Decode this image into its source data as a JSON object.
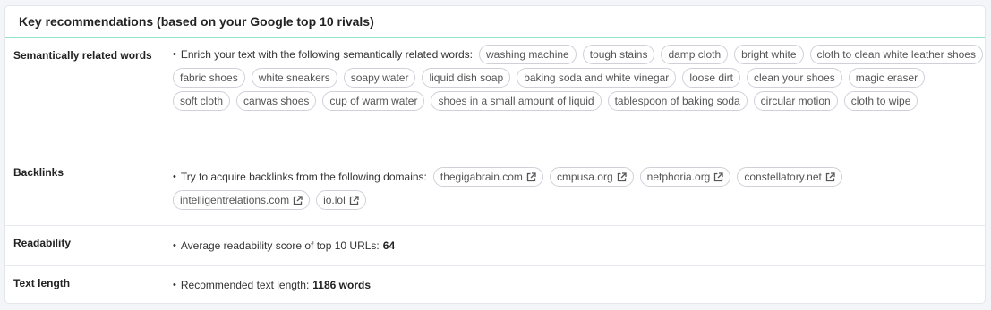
{
  "header": {
    "title": "Key recommendations (based on your Google top 10 rivals)"
  },
  "semantic": {
    "label": "Semantically related words",
    "intro": "Enrich your text with the following semantically related words:",
    "words": [
      "washing machine",
      "tough stains",
      "damp cloth",
      "bright white",
      "cloth to clean white leather shoes",
      "fabric shoes",
      "white sneakers",
      "soapy water",
      "liquid dish soap",
      "baking soda and white vinegar",
      "loose dirt",
      "clean your shoes",
      "magic eraser",
      "soft cloth",
      "canvas shoes",
      "cup of warm water",
      "shoes in a small amount of liquid",
      "tablespoon of baking soda",
      "circular motion",
      "cloth to wipe"
    ]
  },
  "backlinks": {
    "label": "Backlinks",
    "intro": "Try to acquire backlinks from the following domains:",
    "domains": [
      "thegigabrain.com",
      "cmpusa.org",
      "netphoria.org",
      "constellatory.net",
      "intelligentrelations.com",
      "io.lol"
    ]
  },
  "readability": {
    "label": "Readability",
    "text": "Average readability score of top 10 URLs:",
    "value": "64"
  },
  "text_length": {
    "label": "Text length",
    "text": "Recommended text length:",
    "value": "1186 words"
  }
}
